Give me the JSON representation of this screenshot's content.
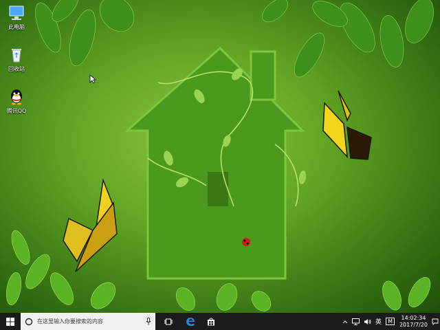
{
  "desktop": {
    "icons": [
      {
        "label": "此电脑",
        "icon": "computer-icon"
      },
      {
        "label": "回收站",
        "icon": "recycle-bin-icon"
      },
      {
        "label": "腾讯QQ",
        "icon": "qq-penguin-icon"
      }
    ]
  },
  "taskbar": {
    "search_placeholder": "在这里输入你要搜索的内容",
    "ime_label": "英",
    "ime_mode": "M",
    "time": "14:02:34",
    "date": "2017/7/20"
  },
  "colors": {
    "taskbar": "#1c1c1c",
    "edge_blue": "#1e88e5",
    "qq_red": "#d9261c"
  }
}
